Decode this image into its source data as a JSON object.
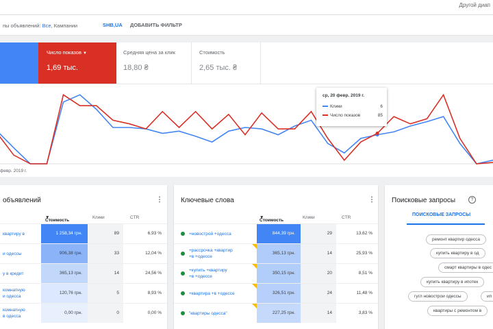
{
  "header": {
    "other_dates": "Другой диап"
  },
  "filter": {
    "prefix": "пы объявлений: ",
    "value1": "Все",
    "mid": ", Кампании",
    "chip": "SHB,UA",
    "add": "ДОБАВИТЬ ФИЛЬТР"
  },
  "scorecards": {
    "impressions_label": "Число показов",
    "impressions_value": "1,69 тыс.",
    "avg_cpc_label": "Средняя цена за клик",
    "avg_cpc_value": "18,80 ₴",
    "cost_label": "Стоимость",
    "cost_value": "2,65 тыс. ₴"
  },
  "chart_data": {
    "type": "line",
    "x_start_label": "февр. 2019 г.",
    "ylim": [
      0,
      100
    ],
    "series": [
      {
        "name": "Клики",
        "color": "#4285f4",
        "values": [
          45,
          22,
          0,
          0,
          85,
          95,
          75,
          50,
          50,
          48,
          42,
          45,
          38,
          30,
          45,
          50,
          48,
          40,
          52,
          60,
          28,
          15,
          35,
          40,
          44,
          52,
          58,
          65,
          28,
          0,
          5
        ]
      },
      {
        "name": "Число показов",
        "color": "#d93025",
        "values": [
          42,
          12,
          0,
          0,
          95,
          80,
          80,
          60,
          55,
          48,
          72,
          50,
          72,
          48,
          68,
          40,
          70,
          48,
          48,
          72,
          35,
          5,
          30,
          42,
          65,
          55,
          62,
          95,
          35,
          0,
          2
        ]
      }
    ],
    "marker_index": 23,
    "tooltip": {
      "date": "ср, 20 февр. 2019 г.",
      "clicks_label": "Клики",
      "clicks_value": "6",
      "impressions_label": "Число показов",
      "impressions_value": "85"
    }
  },
  "ads_table": {
    "title": "объявлений",
    "menu": "⋮",
    "headers": {
      "cost": "Стоимость",
      "clicks": "Клики",
      "ctr": "CTR"
    },
    "rows": [
      {
        "line1": "квартиру в",
        "line2": "",
        "cost": "1 258,34 грн.",
        "clicks": "89",
        "ctr": "6,93 %",
        "shade": 1.0
      },
      {
        "line1": "и одессы",
        "line2": "",
        "cost": "906,38 грн.",
        "clicks": "33",
        "ctr": "12,04 %",
        "shade": 0.72
      },
      {
        "line1": "у в кредит",
        "line2": "",
        "cost": "365,13 грн.",
        "clicks": "14",
        "ctr": "24,56 %",
        "shade": 0.29
      },
      {
        "line1": "комнатную",
        "line2": "и одесса",
        "cost": "120,76 грн.",
        "clicks": "5",
        "ctr": "8,93 %",
        "shade": 0.1
      },
      {
        "line1": "комнатную",
        "line2": "в одесса",
        "cost": "0,00 грн.",
        "clicks": "0",
        "ctr": "0,00 %",
        "shade": 0.0
      }
    ]
  },
  "keywords_table": {
    "title": "Ключевые слова",
    "menu": "⋮",
    "headers": {
      "cost": "Стоимость",
      "clicks": "Клики",
      "ctr": "CTR"
    },
    "rows": [
      {
        "line1": "+новострой +одесса",
        "line2": "",
        "cost": "844,39 грн.",
        "clicks": "29",
        "ctr": "13,62 %",
        "shade": 1.0,
        "flag": false
      },
      {
        "line1": "+рассрочка +квартир",
        "line2": "+в +одессе",
        "cost": "365,13 грн.",
        "clicks": "14",
        "ctr": "25,93 %",
        "shade": 0.43,
        "flag": true
      },
      {
        "line1": "+купить +квартиру",
        "line2": "+в +одессе",
        "cost": "350,15 грн.",
        "clicks": "20",
        "ctr": "8,51 %",
        "shade": 0.41,
        "flag": true
      },
      {
        "line1": "+квартира +в +одессе",
        "line2": "",
        "cost": "326,51 грн.",
        "clicks": "24",
        "ctr": "11,48 %",
        "shade": 0.39,
        "flag": true
      },
      {
        "line1": "\"квартиры одесса\"",
        "line2": "",
        "cost": "227,25 грн.",
        "clicks": "14",
        "ctr": "3,83 %",
        "shade": 0.27,
        "flag": true
      }
    ]
  },
  "search_terms": {
    "title": "Поисковые запросы",
    "help": "?",
    "tab": "ПОИСКОВЫЕ ЗАПРОСЫ",
    "terms": [
      "ремонт квартир одесса",
      "купить квартиру в од",
      "смарт квартиры в одес",
      "купить квартиру в ипотек",
      "гугл новострои одессы",
      "ип",
      "квартиры с ремонтом в"
    ]
  }
}
